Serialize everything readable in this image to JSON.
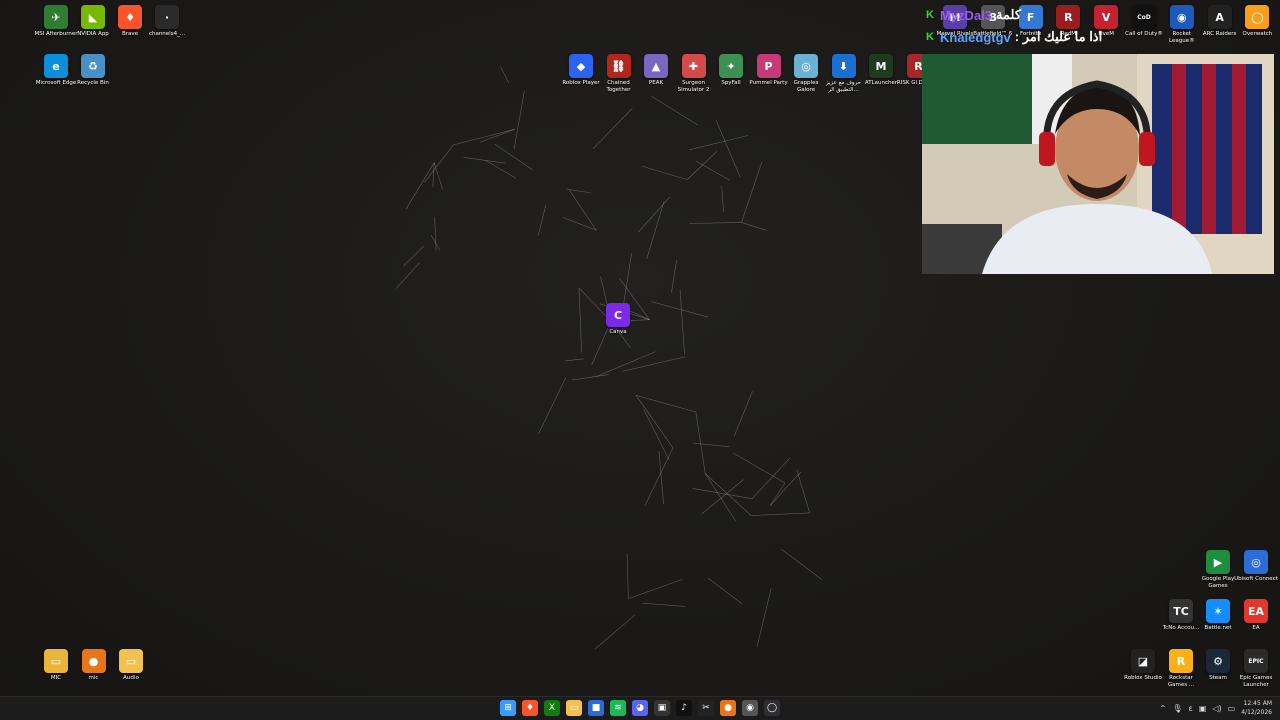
{
  "desktop": {
    "left_icons": [
      {
        "label": "MSI Afterburner",
        "color": "#2e7d32",
        "glyph": "✈"
      },
      {
        "label": "NVIDIA App",
        "color": "#76b900",
        "glyph": "◣"
      },
      {
        "label": "Brave",
        "color": "#fb542b",
        "glyph": "♦"
      },
      {
        "label": "channels4_...",
        "color": "#2a2a2a",
        "glyph": "·"
      },
      {
        "label": "Microsoft Edge",
        "color": "#0c8fd8",
        "glyph": "e"
      },
      {
        "label": "Recycle Bin",
        "color": "#4a90c8",
        "glyph": "♻"
      }
    ],
    "top_row_icons": [
      {
        "label": "Roblox Player",
        "color": "#2b64f3",
        "glyph": "◆"
      },
      {
        "label": "Chained Together",
        "color": "#b0281c",
        "glyph": "⛓"
      },
      {
        "label": "PEAK",
        "color": "#7a68c0",
        "glyph": "▲"
      },
      {
        "label": "Surgeon Simulator 2",
        "color": "#d44a4a",
        "glyph": "✚"
      },
      {
        "label": "SpyFall",
        "color": "#3d8f54",
        "glyph": "✦"
      },
      {
        "label": "Pummel Party",
        "color": "#c53a77",
        "glyph": "P"
      },
      {
        "label": "Grapples Galore",
        "color": "#6ab1d4",
        "glyph": "◎"
      },
      {
        "label": "حروف مع عزيز التطبيق الر...",
        "color": "#1c6fd1",
        "glyph": "⬇"
      },
      {
        "label": "ATLauncher",
        "color": "#1f3a1f",
        "glyph": "M"
      },
      {
        "label": "RISK Gl Domina",
        "color": "#a8262a",
        "glyph": "R"
      }
    ],
    "top_right_icons": [
      {
        "label": "Marvel Rivals",
        "color": "#5a3ea8",
        "glyph": "M"
      },
      {
        "label": "Battlefield™ 6",
        "color": "#555",
        "glyph": "B"
      },
      {
        "label": "Fortnite",
        "color": "#3677d4",
        "glyph": "F"
      },
      {
        "label": "RedM",
        "color": "#9c1d1d",
        "glyph": "R"
      },
      {
        "label": "FiveM",
        "color": "#c42231",
        "glyph": "V"
      },
      {
        "label": "Call of Duty®",
        "color": "#111",
        "glyph": "CoD"
      },
      {
        "label": "Rocket League®",
        "color": "#1e5bb8",
        "glyph": "◉"
      },
      {
        "label": "ARC Raiders",
        "color": "#222",
        "glyph": "A"
      },
      {
        "label": "Overwatch",
        "color": "#f99e1a",
        "glyph": "◯"
      }
    ],
    "center_icon": {
      "label": "Canva",
      "color": "#7d2ae8",
      "glyph": "C"
    },
    "bottom_left_icons": [
      {
        "label": "MIC",
        "color": "#e8b53a",
        "glyph": "▭"
      },
      {
        "label": "mic",
        "color": "#e8751a",
        "glyph": "●"
      },
      {
        "label": "Audio",
        "color": "#f2c14e",
        "glyph": "▭"
      }
    ],
    "bottom_right_icons": [
      {
        "label": "Google Play Games",
        "color": "#1e8e3e",
        "glyph": "▶"
      },
      {
        "label": "Ubisoft Connect",
        "color": "#2c6cd8",
        "glyph": "◎"
      },
      {
        "label": "TcNo Accou...",
        "color": "#333",
        "glyph": "TC"
      },
      {
        "label": "Battle.net",
        "color": "#148eff",
        "glyph": "✶"
      },
      {
        "label": "EA",
        "color": "#e3362c",
        "glyph": "EA"
      },
      {
        "label": "Roblox Studio",
        "color": "#222",
        "glyph": "◪"
      },
      {
        "label": "Rockstar Games ...",
        "color": "#fcaf17",
        "glyph": "R"
      },
      {
        "label": "Steam",
        "color": "#1b2838",
        "glyph": "⚙"
      },
      {
        "label": "Epic Games Launcher",
        "color": "#2a2a2a",
        "glyph": "EPIC"
      }
    ]
  },
  "chat": [
    {
      "badge": "K",
      "user": "MyzDal3",
      "message": "كلمة"
    },
    {
      "badge": "K",
      "user": "Khaledgtgv",
      "message": ": اذا ما عليك امر"
    }
  ],
  "taskbar": {
    "apps": [
      {
        "name": "start",
        "color": "#3a9bff",
        "glyph": "⊞"
      },
      {
        "name": "brave",
        "color": "#fb542b",
        "glyph": "♦"
      },
      {
        "name": "xbox",
        "color": "#107c10",
        "glyph": "X"
      },
      {
        "name": "explorer",
        "color": "#f2c14e",
        "glyph": "▭"
      },
      {
        "name": "store",
        "color": "#2b6dd6",
        "glyph": "■"
      },
      {
        "name": "spotify",
        "color": "#1db954",
        "glyph": "≋"
      },
      {
        "name": "discord",
        "color": "#5865f2",
        "glyph": "◕"
      },
      {
        "name": "capcut",
        "color": "#333",
        "glyph": "▣"
      },
      {
        "name": "tiktok",
        "color": "#111",
        "glyph": "♪"
      },
      {
        "name": "capcut2",
        "color": "#222",
        "glyph": "✂"
      },
      {
        "name": "fl-studio",
        "color": "#e8751a",
        "glyph": "●"
      },
      {
        "name": "chrome",
        "color": "#555",
        "glyph": "◉"
      },
      {
        "name": "obs",
        "color": "#302e31",
        "glyph": "◯"
      }
    ],
    "time": "12:45 AM",
    "date": "4/12/2026"
  }
}
